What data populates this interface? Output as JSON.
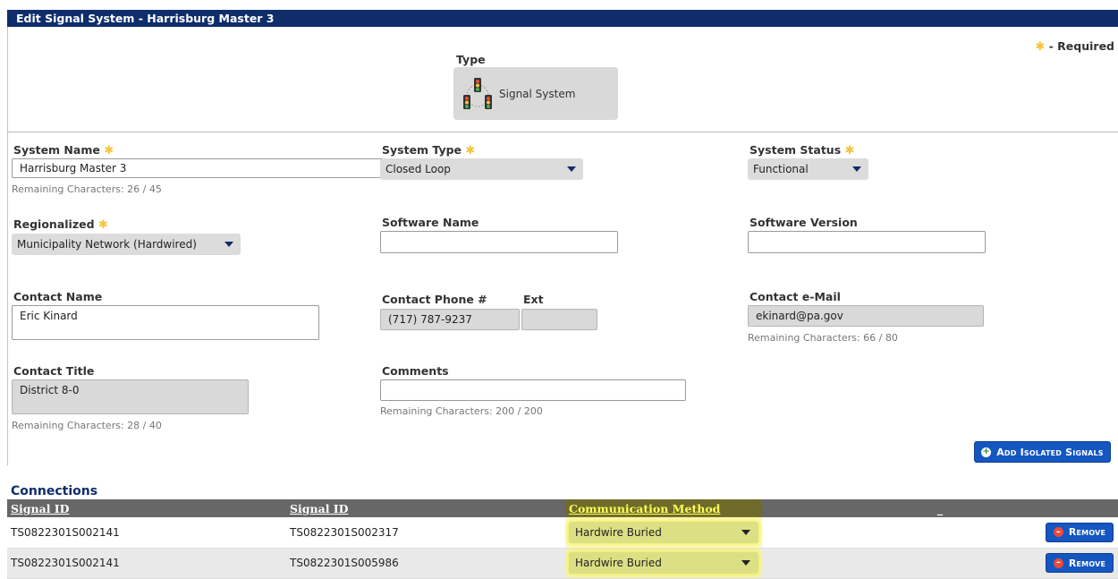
{
  "window": {
    "title": "Edit Signal System - Harrisburg Master 3"
  },
  "required_note": "- Required",
  "type": {
    "label": "Type",
    "value": "Signal System",
    "icon": "traffic-signal-network-icon"
  },
  "form": {
    "system_name": {
      "label": "System Name",
      "value": "Harrisburg Master 3",
      "remaining": "Remaining Characters: 26 / 45"
    },
    "system_type": {
      "label": "System Type",
      "value": "Closed Loop"
    },
    "system_status": {
      "label": "System Status",
      "value": "Functional"
    },
    "regionalized": {
      "label": "Regionalized",
      "value": "Municipality Network (Hardwired)"
    },
    "software_name": {
      "label": "Software Name",
      "value": ""
    },
    "software_version": {
      "label": "Software Version",
      "value": ""
    },
    "contact_name": {
      "label": "Contact Name",
      "value": "Eric Kinard"
    },
    "contact_phone": {
      "label": "Contact Phone #",
      "value": "(717) 787-9237"
    },
    "ext": {
      "label": "Ext",
      "value": ""
    },
    "contact_email": {
      "label": "Contact e-Mail",
      "value": "ekinard@pa.gov",
      "remaining": "Remaining Characters: 66 / 80"
    },
    "contact_title": {
      "label": "Contact Title",
      "value": "District 8-0",
      "remaining": "Remaining Characters: 28 / 40"
    },
    "comments": {
      "label": "Comments",
      "value": "",
      "remaining": "Remaining Characters: 200 / 200"
    }
  },
  "buttons": {
    "add_isolated_signals": "Add Isolated Signals",
    "remove": "Remove"
  },
  "connections": {
    "title": "Connections",
    "columns": [
      "Signal ID",
      "Signal ID",
      "Communication Method",
      "_"
    ],
    "rows": [
      {
        "signal_a": "TS0822301S002141",
        "signal_b": "TS0822301S002317",
        "method": "Hardwire Buried"
      },
      {
        "signal_a": "TS0822301S002141",
        "signal_b": "TS0822301S005986",
        "method": "Hardwire Buried"
      }
    ]
  },
  "colors": {
    "header_bg": "#0f2d6b",
    "button_bg": "#1557c0",
    "required_star": "#f4c43a",
    "highlight": "#f4f261"
  }
}
